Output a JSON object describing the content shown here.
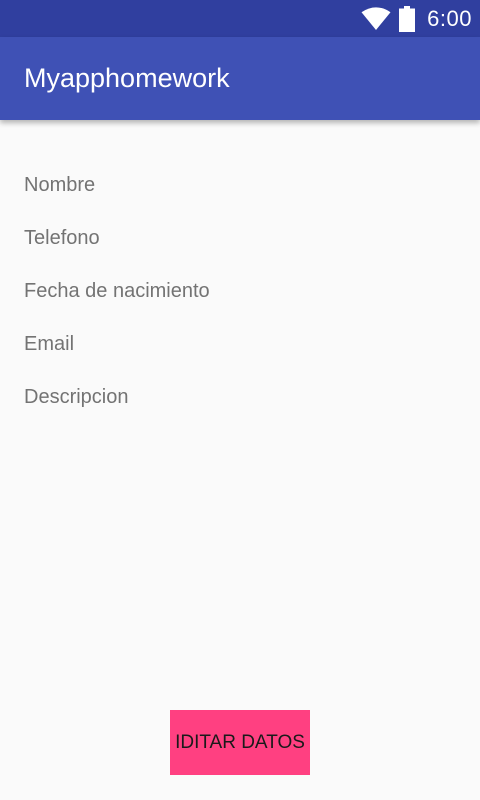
{
  "status_bar": {
    "time": "6:00",
    "icons": [
      "wifi-icon",
      "battery-icon"
    ]
  },
  "app_bar": {
    "title": "Myapphomework"
  },
  "fields": [
    "Nombre",
    "Telefono",
    "Fecha de nacimiento",
    "Email",
    "Descripcion"
  ],
  "edit_button": {
    "label": "IDITAR DATOS"
  },
  "colors": {
    "status_bar": "#303f9f",
    "app_bar": "#3f51b5",
    "accent": "#ff4081",
    "background": "#fafafa",
    "label_text": "#737373"
  }
}
